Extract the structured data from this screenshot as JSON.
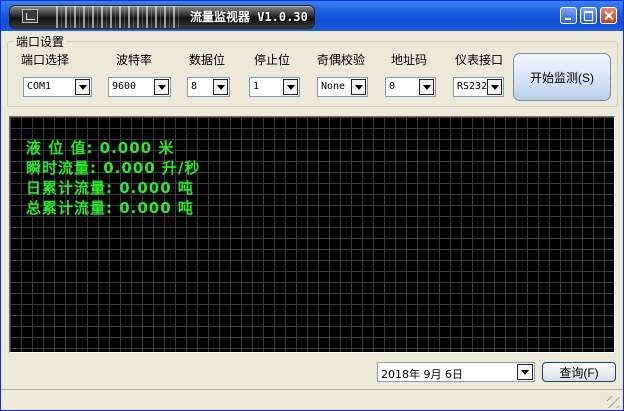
{
  "window": {
    "title": "流量监视器 V1.0.30"
  },
  "port_settings": {
    "group_label": "端口设置",
    "fields": [
      {
        "label": "端口选择",
        "value": "COM1"
      },
      {
        "label": "波特率",
        "value": "9600"
      },
      {
        "label": "数据位",
        "value": "8"
      },
      {
        "label": "停止位",
        "value": "1"
      },
      {
        "label": "奇偶校验",
        "value": "None"
      },
      {
        "label": "地址码",
        "value": "0"
      },
      {
        "label": "仪表接口",
        "value": "RS232"
      }
    ],
    "start_button": "开始监测(S)"
  },
  "display": {
    "lines": [
      "液 位 值: 0.000 米",
      "瞬时流量: 0.000 升/秒",
      "日累计流量: 0.000 吨",
      "总累计流量: 0.000 吨"
    ],
    "text_color": "#2ee62e",
    "background": "#000000"
  },
  "query": {
    "date": "2018年 9月 6日",
    "button": "查询(F)"
  },
  "colors": {
    "window_bg": "#ece9d8",
    "title_bar": "#1a5ce0"
  }
}
